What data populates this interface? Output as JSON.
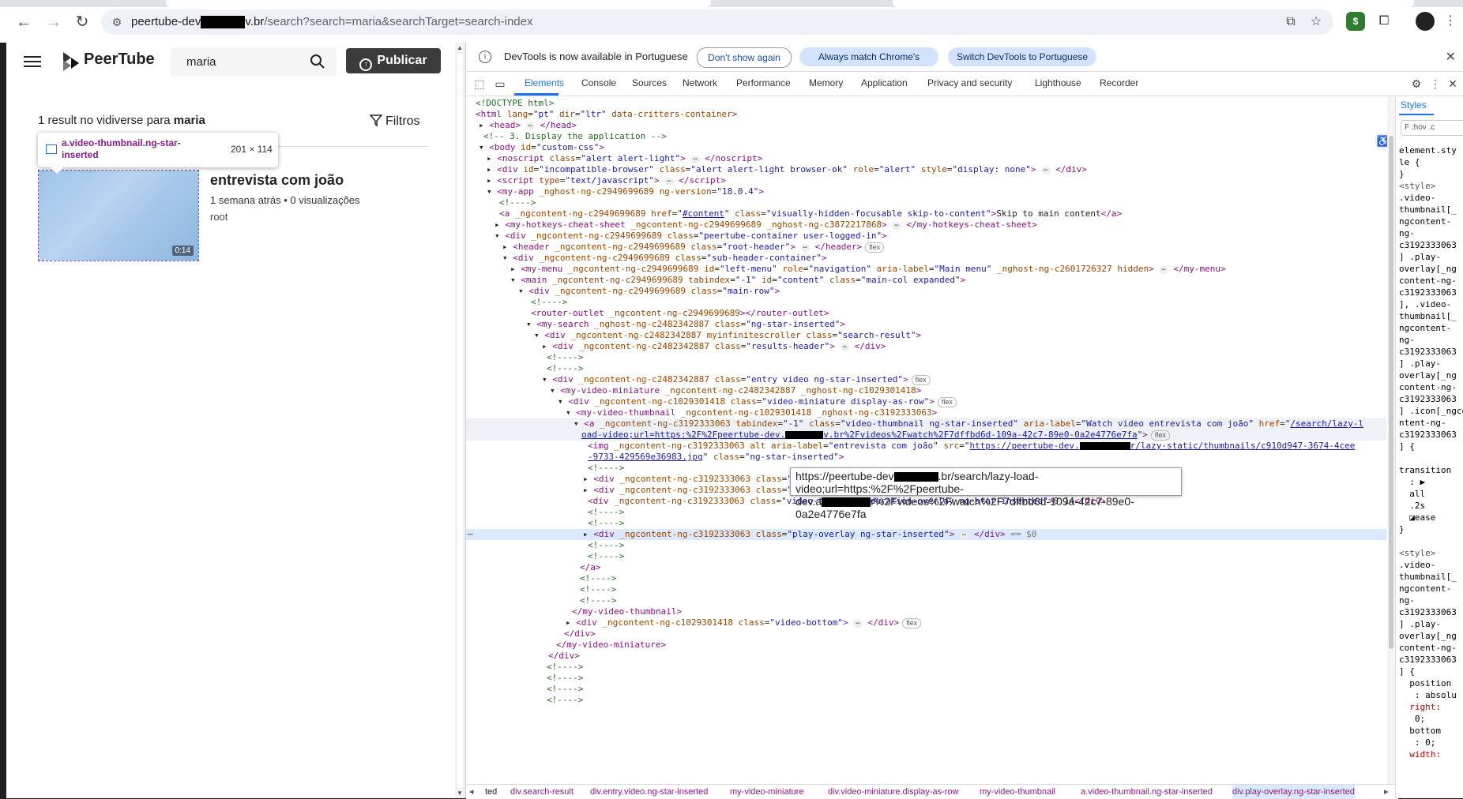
{
  "browser": {
    "url_host": "peertube-dev",
    "url_tail": "v.br",
    "url_path": "/search?search=maria&searchTarget=search-index"
  },
  "page": {
    "brand": "PeerTube",
    "search_value": "maria",
    "publish_label": "Publicar",
    "results_count": "1 result no vidiverse para",
    "results_query": "maria",
    "filters_label": "Filtros",
    "tooltip_selector": "a.video-thumbnail.ng-star-inserted",
    "tooltip_size": "201 × 114",
    "duration": "0:14",
    "video_title": "entrevista com joão",
    "video_meta": "1 semana atrás • 0 visualizações",
    "video_channel": "root"
  },
  "devtools": {
    "info_text": "DevTools is now available in Portuguese",
    "btn_dont_show": "Don't show again",
    "btn_always_match": "Always match Chrome's language",
    "btn_switch": "Switch DevTools to Portuguese",
    "tabs": [
      "Elements",
      "Console",
      "Sources",
      "Network",
      "Performance",
      "Memory",
      "Application",
      "Privacy and security",
      "Lighthouse",
      "Recorder"
    ],
    "url_tooltip_line1": "https://peertube-dev",
    "url_tooltip_line1b": ".br/search/lazy-load-video;url=https:%2F%2Fpeertube-",
    "url_tooltip_line2a": "dev.a",
    "url_tooltip_line2b": "r%2Fvideos%2Fwatch%2F7dffbd6d-109a-42c7-89e0-0a2e4776e7fa",
    "breadcrumbs": [
      "ted",
      "div.search-result",
      "div.entry.video.ng-star-inserted",
      "my-video-miniature",
      "div.video-miniature.display-as-row",
      "my-video-thumbnail",
      "a.video-thumbnail.ng-star-inserted",
      "div.play-overlay.ng-star-inserted"
    ],
    "styles_tab": "Styles",
    "styles_filter": "F  :hov .c",
    "styles_lines": [
      "element.sty",
      "le {",
      "}",
      "<style>",
      ".video-",
      "thumbnail[_",
      "ngcontent-",
      "ng-",
      "c3192333063",
      "] .play-",
      "overlay[_ng",
      "content-ng-",
      "c3192333063",
      "], .video-",
      "thumbnail[_",
      "ngcontent-",
      "ng-",
      "c3192333063",
      "] .play-",
      "overlay[_ng",
      "content-ng-",
      "c3192333063",
      "] .icon[_ngco",
      "ntent-ng-",
      "c3192333063",
      "] {",
      "",
      "transition",
      "  : ▶",
      "  all",
      "  .2s",
      "  ◪ease",
      "}",
      "",
      "<style>",
      ".video-",
      "thumbnail[_",
      "ngcontent-",
      "ng-",
      "c3192333063",
      "] .play-",
      "overlay[_ng",
      "content-ng-",
      "c3192333063",
      "] {",
      "  position",
      "   : absolu",
      "  right:",
      "   0;",
      "  bottom",
      "   : 0;",
      "  width:"
    ]
  }
}
